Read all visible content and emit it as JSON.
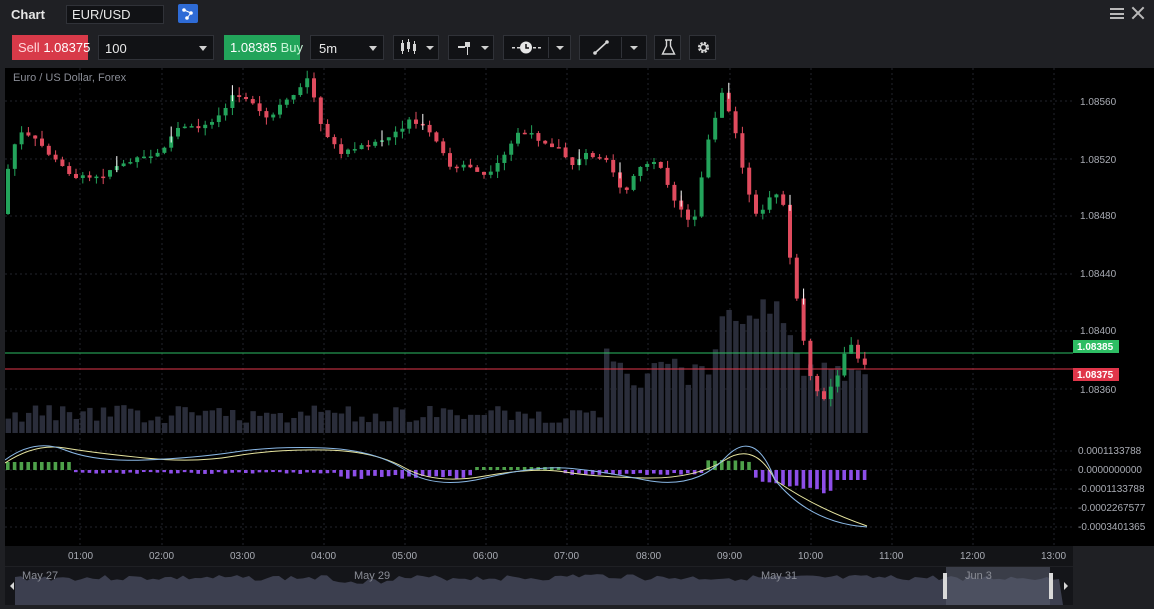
{
  "window": {
    "title": "Chart"
  },
  "symbol": {
    "value": "EUR/USD"
  },
  "toolbar": {
    "sell_label": "Sell",
    "sell_price": "1.08375",
    "quantity": "100",
    "buy_price": "1.08385",
    "buy_label": "Buy",
    "timeframe": "5m",
    "icons": [
      "candlestick-chart-icon",
      "order-marker-icon",
      "clock-line-icon",
      "drawing-line-icon",
      "flask-icon",
      "gear-icon"
    ]
  },
  "chart": {
    "instrument_label": "Euro / US Dollar, Forex",
    "price_ticks": [
      "1.08560",
      "1.08520",
      "1.08480",
      "1.08440",
      "1.08400",
      "1.08360"
    ],
    "oscillator_ticks": [
      "0.0001133788",
      "0.0000000000",
      "-0.0001133788",
      "-0.0002267577",
      "-0.0003401365"
    ],
    "time_ticks": [
      "01:00",
      "02:00",
      "03:00",
      "04:00",
      "05:00",
      "06:00",
      "07:00",
      "08:00",
      "09:00",
      "10:00",
      "11:00",
      "12:00",
      "13:00"
    ],
    "buy_line": {
      "price": "1.08385",
      "color": "#2dbd63"
    },
    "sell_line": {
      "price": "1.08375",
      "color": "#e0364a"
    }
  },
  "navigator": {
    "dates": [
      "May 27",
      "May 29",
      "May 31",
      "Jun 3"
    ]
  },
  "colors": {
    "up": "#23a35b",
    "down": "#e04b5e",
    "volume": "#2a2d3a",
    "macd_up": "#4ea14a",
    "macd_down": "#8d4ee8",
    "signal": "#e8e6a0",
    "macd_line": "#8ab8e6"
  }
}
